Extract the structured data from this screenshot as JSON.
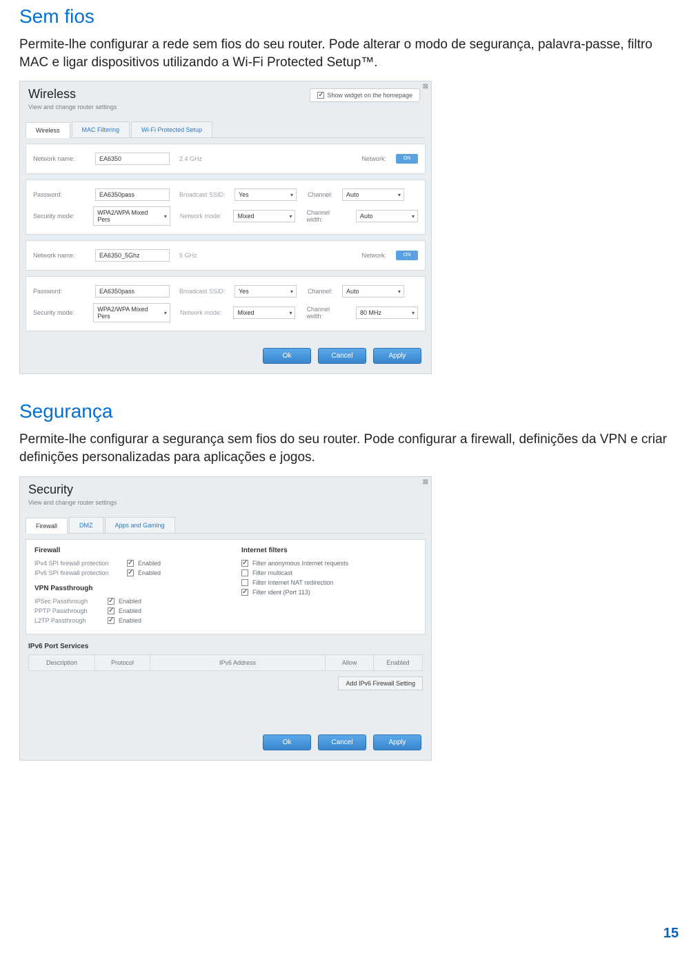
{
  "page_number": "15",
  "s1": {
    "heading": "Sem fios",
    "desc": "Permite-lhe configurar a rede sem fios do seu router. Pode alterar o modo de segurança, palavra-passe, filtro MAC e ligar dispositivos utilizando a Wi-Fi Protected Setup™.",
    "panel": {
      "title": "Wireless",
      "subtitle": "View and change router settings",
      "widget_label": "Show widget on the homepage",
      "tabs": {
        "t1": "Wireless",
        "t2": "MAC Filtering",
        "t3": "Wi-Fi Protected Setup"
      },
      "labels": {
        "network_name": "Network name:",
        "password": "Password:",
        "security_mode": "Security mode:",
        "broadcast_ssid": "Broadcast SSID:",
        "network_mode": "Network mode:",
        "channel": "Channel:",
        "channel_width": "Channel width:",
        "network": "Network:",
        "on": "ON"
      },
      "band24": {
        "ghz": "2.4 GHz",
        "name": "EA6350",
        "password": "EA6350pass",
        "security": "WPA2/WPA Mixed Pers",
        "bcast": "Yes",
        "mode": "Mixed",
        "channel": "Auto",
        "width": "Auto"
      },
      "band5": {
        "ghz": "5 GHz",
        "name": "EA6350_5Ghz",
        "password": "EA6350pass",
        "security": "WPA2/WPA Mixed Pers",
        "bcast": "Yes",
        "mode": "Mixed",
        "channel": "Auto",
        "width": "80 MHz"
      },
      "buttons": {
        "ok": "Ok",
        "cancel": "Cancel",
        "apply": "Apply"
      }
    }
  },
  "s2": {
    "heading": "Segurança",
    "desc": "Permite-lhe configurar a segurança sem fios do seu router. Pode configurar a firewall, definições da VPN e criar definições personalizadas para aplicações e jogos.",
    "panel": {
      "title": "Security",
      "subtitle": "View and change router settings",
      "tabs": {
        "t1": "Firewall",
        "t2": "DMZ",
        "t3": "Apps and Gaming"
      },
      "firewall_h": "Firewall",
      "internet_h": "Internet filters",
      "vpn_h": "VPN Passthrough",
      "enabled": "Enabled",
      "fw": {
        "v4": "IPv4 SPI firewall protection",
        "v6": "IPv6 SPI firewall protection"
      },
      "vpn": {
        "ipsec": "IPSec Passthrough",
        "pptp": "PPTP Passthrough",
        "l2tp": "L2TP Passthrough"
      },
      "filters": {
        "anon": "Filter anonymous Internet requests",
        "multi": "Filter multicast",
        "nat": "Filter Internet NAT redirection",
        "ident": "Filter ident (Port 113)"
      },
      "ipv6_h": "IPv6 Port Services",
      "cols": {
        "desc": "Description",
        "proto": "Protocol",
        "addr": "IPv6 Address",
        "allow": "Allow",
        "enabled": "Enabled"
      },
      "addbtn": "Add IPv6 Firewall Setting",
      "buttons": {
        "ok": "Ok",
        "cancel": "Cancel",
        "apply": "Apply"
      }
    }
  }
}
